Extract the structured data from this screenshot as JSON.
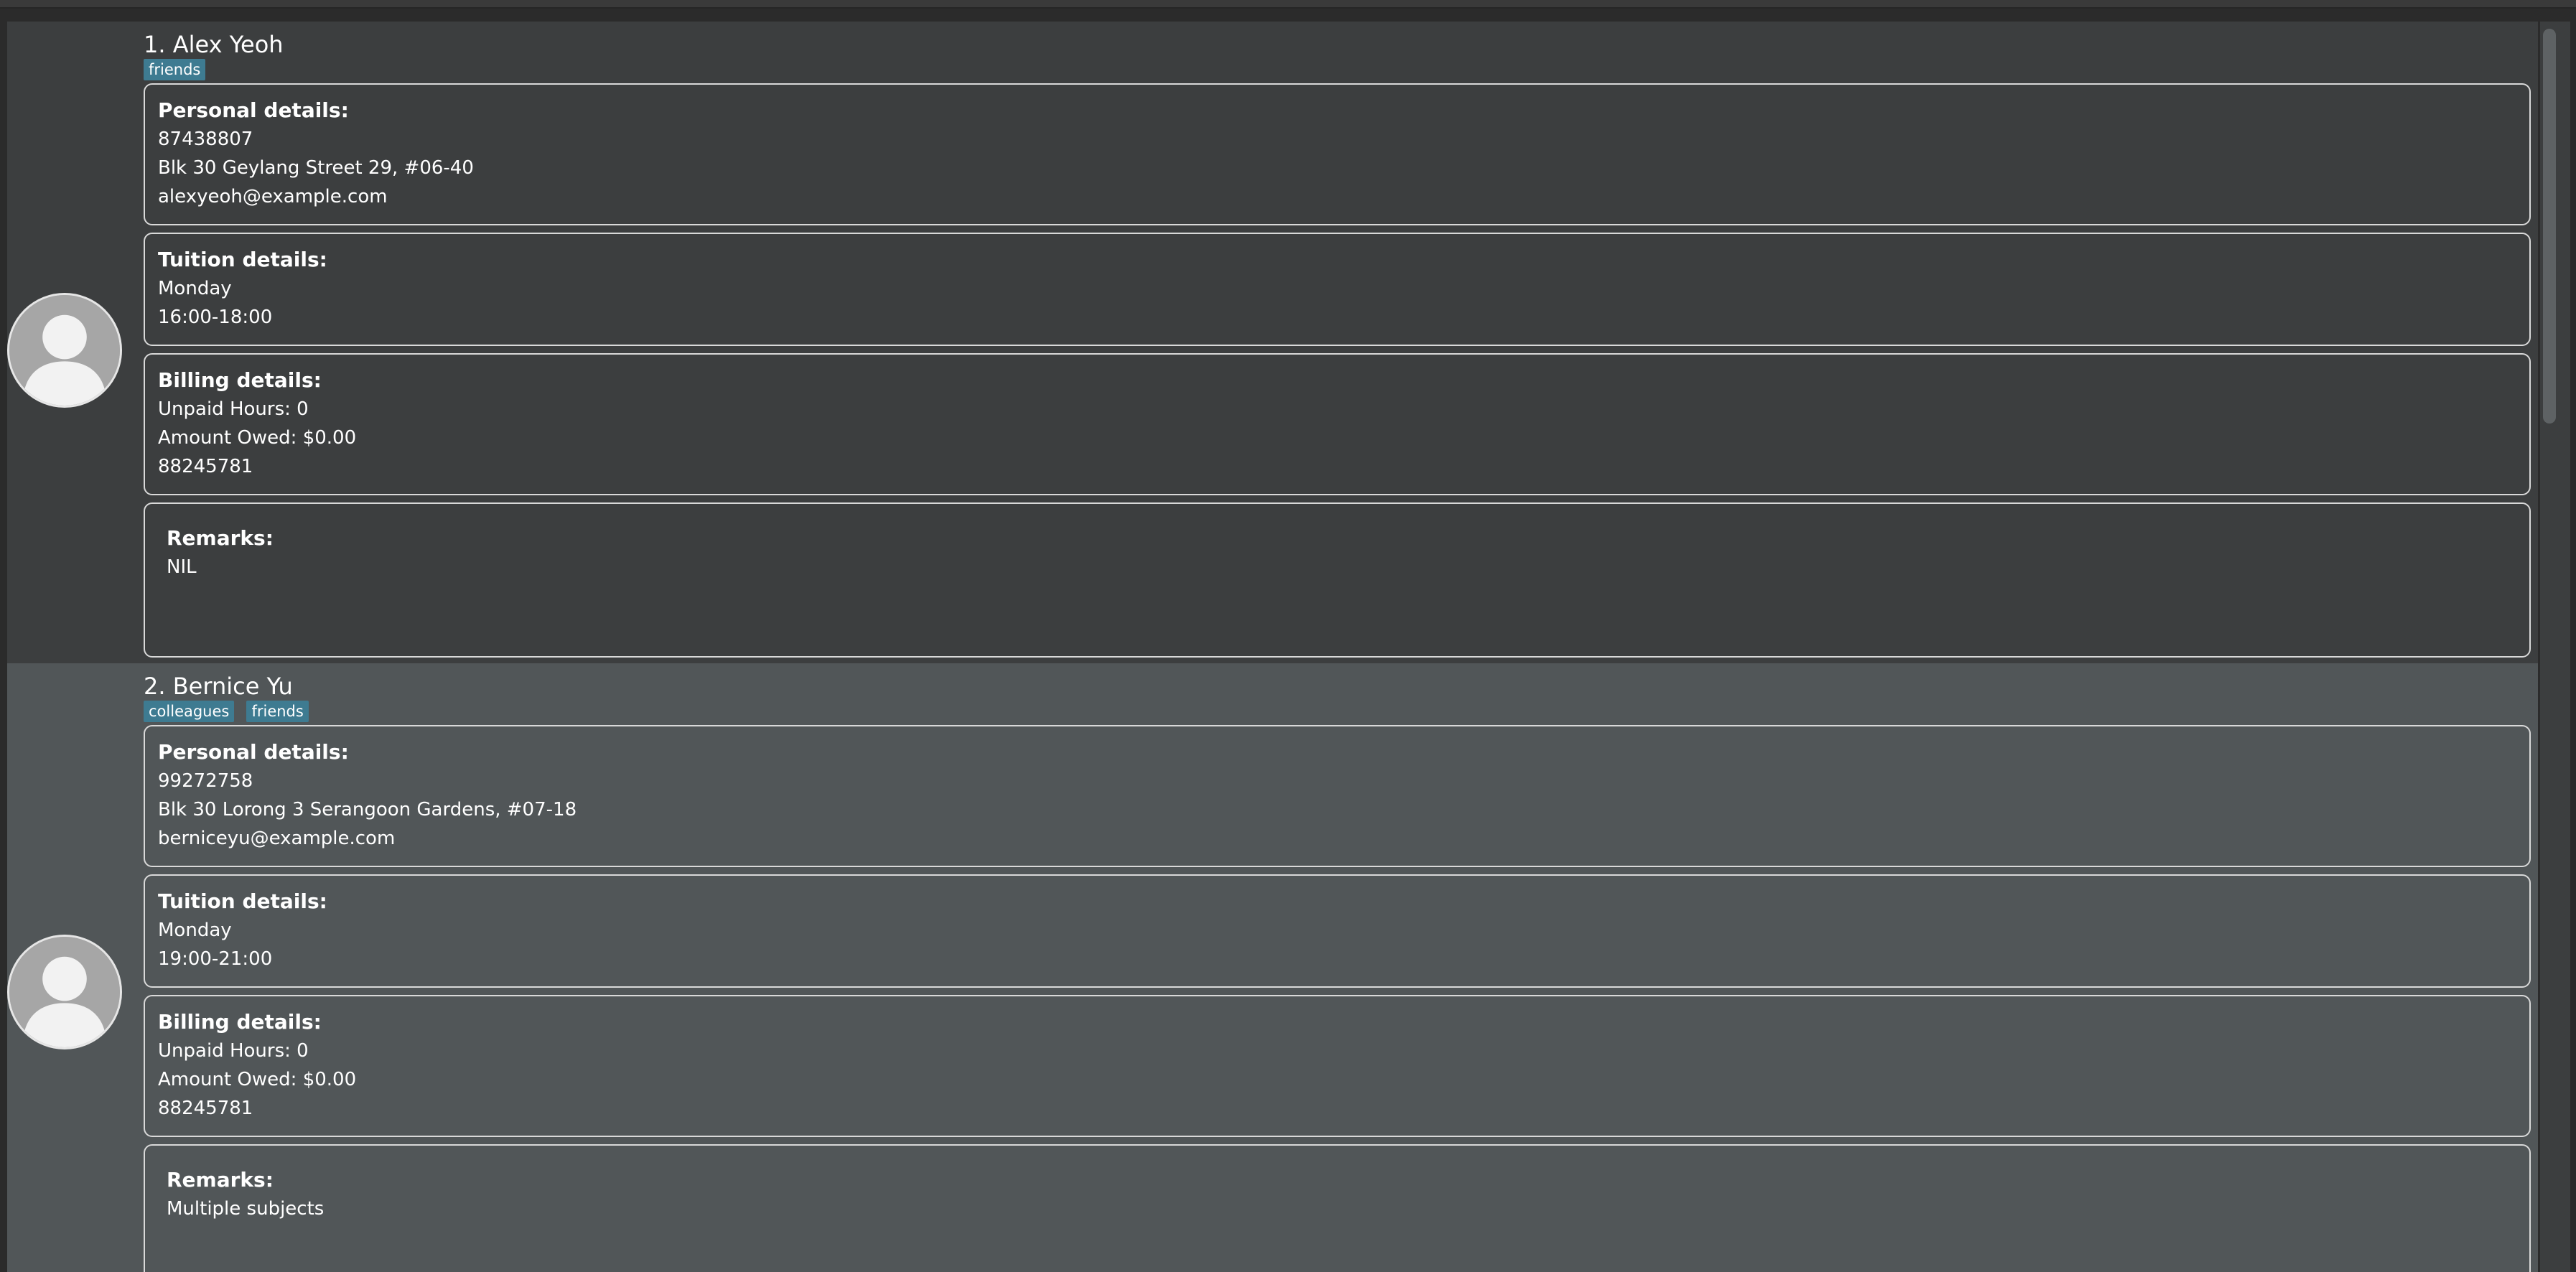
{
  "persons": [
    {
      "index": "1.",
      "name": "Alex Yeoh",
      "tags": [
        "friends"
      ],
      "personal": {
        "label": "Personal details:",
        "phone": "87438807",
        "address": "Blk 30 Geylang Street 29, #06-40",
        "email": "alexyeoh@example.com"
      },
      "tuition": {
        "label": "Tuition details:",
        "day": "Monday",
        "time": "16:00-18:00"
      },
      "billing": {
        "label": "Billing details:",
        "unpaid_hours": "Unpaid Hours: 0",
        "amount_owed": "Amount Owed: $0.00",
        "account": "88245781"
      },
      "remarks": {
        "label": "Remarks:",
        "text": "NIL"
      }
    },
    {
      "index": "2.",
      "name": "Bernice Yu",
      "tags": [
        "colleagues",
        "friends"
      ],
      "personal": {
        "label": "Personal details:",
        "phone": "99272758",
        "address": "Blk 30 Lorong 3 Serangoon Gardens, #07-18",
        "email": "berniceyu@example.com"
      },
      "tuition": {
        "label": "Tuition details:",
        "day": "Monday",
        "time": "19:00-21:00"
      },
      "billing": {
        "label": "Billing details:",
        "unpaid_hours": "Unpaid Hours: 0",
        "amount_owed": "Amount Owed: $0.00",
        "account": "88245781"
      },
      "remarks": {
        "label": "Remarks:",
        "text": "Multiple subjects"
      }
    }
  ],
  "colors": {
    "background": "#2b2b2b",
    "card_default": "#3c3e3f",
    "card_selected": "#515658",
    "tag": "#3e7b91",
    "border": "#d9d9d9"
  },
  "icons": {
    "avatar": "user-placeholder-icon"
  }
}
